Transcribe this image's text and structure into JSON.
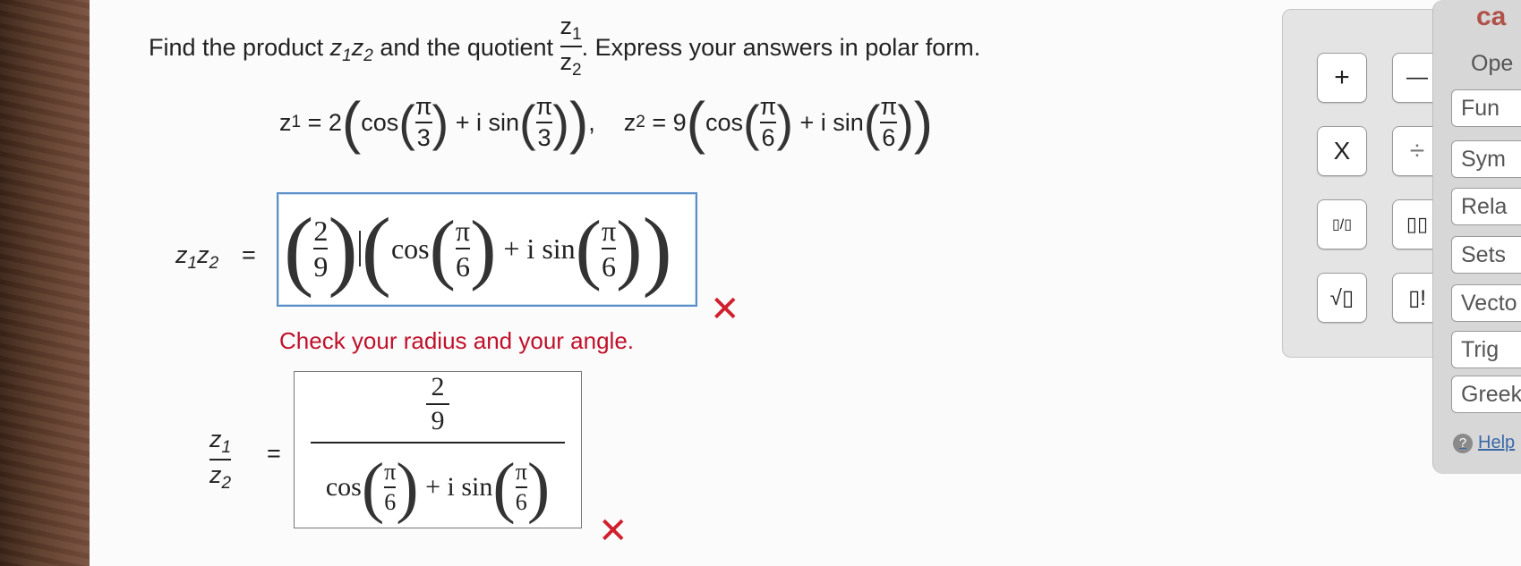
{
  "question": {
    "prefix": "Find the product",
    "product": "z",
    "sub1": "1",
    "sub2": "2",
    "middle": "and the quotient",
    "suffix": ". Express your answers in polar form."
  },
  "given": {
    "z1_lhs": "z",
    "z1_sub": "1",
    "z1_coef": "= 2",
    "z1_angle_num": "π",
    "z1_angle_den": "3",
    "z2_lhs": "z",
    "z2_sub": "2",
    "z2_coef": "= 9",
    "z2_angle_num": "π",
    "z2_angle_den": "6",
    "cos": "cos",
    "plus_i_sin": "+ i sin",
    "comma": ","
  },
  "product_answer": {
    "label": "z",
    "eq": "=",
    "coef_num": "2",
    "coef_den": "9",
    "cos": "cos",
    "angle_num": "π",
    "angle_den": "6",
    "plus_i_sin": "+ i sin"
  },
  "feedback": "Check your radius and your angle.",
  "quotient_answer": {
    "num_num": "2",
    "num_den": "9",
    "cos": "cos",
    "angle_num": "π",
    "angle_den": "6",
    "plus_i_sin": "+ i sin",
    "eq": "="
  },
  "incorrect_mark": "✕",
  "palette": {
    "plus": "+",
    "minus": "—",
    "times": "X",
    "divide": "÷",
    "fraction": "▯/▯",
    "exponent": "▯▯",
    "sqrt": "√▯",
    "factorial": "▯!"
  },
  "sidepanel": {
    "title": "ca",
    "tabs": [
      "Ope",
      "Fun",
      "Sym",
      "Rela",
      "Sets",
      "Vecto",
      "Trig",
      "Greek"
    ],
    "help": "Help"
  },
  "colors": {
    "error": "#d0202e",
    "focus_border": "#5b8fc7",
    "panel": "#d7d7d7"
  }
}
